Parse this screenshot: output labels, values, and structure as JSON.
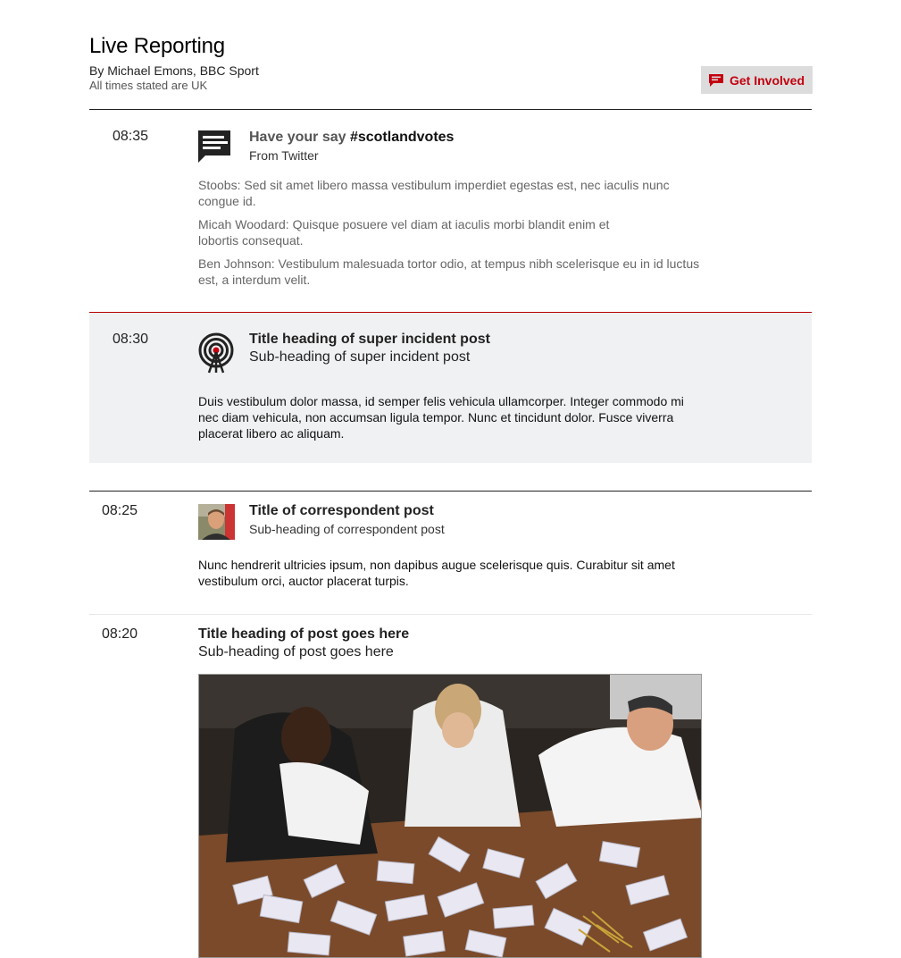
{
  "header": {
    "title": "Live Reporting",
    "byline": "By Michael Emons, BBC Sport",
    "times_note": "All times stated are UK",
    "get_involved_label": "Get Involved"
  },
  "posts": [
    {
      "time": "08:35",
      "title_prefix": "Have your say ",
      "title_hashtag": "#scotlandvotes",
      "source": "From Twitter",
      "icon": "speech-bubble-icon",
      "quotes": [
        "Stoobs: Sed sit amet libero massa vestibulum imperdiet egestas est, nec iaculis nunc congue id.",
        "Micah Woodard: Quisque posuere vel diam at iaculis morbi blandit enim et lobortis consequat.",
        "Ben Johnson: Vestibulum malesuada tortor odio, at tempus nibh scelerisque eu in id luctus est, a interdum velit."
      ]
    },
    {
      "time": "08:30",
      "title": "Title heading of super incident post",
      "subtitle": "Sub-heading of super incident post",
      "icon": "broadcast-tower-icon",
      "body": "Duis vestibulum dolor massa, id semper felis vehicula ullamcorper. Integer commodo mi nec diam vehicula, non accumsan ligula tempor. Nunc et tincidunt dolor. Fusce viverra placerat libero ac aliquam."
    },
    {
      "time": "08:25",
      "title": "Title of correspondent post",
      "subtitle": "Sub-heading of correspondent post",
      "icon": "correspondent-avatar",
      "body": "Nunc hendrerit ultricies ipsum, non dapibus augue scelerisque quis. Curabitur sit amet vestibulum orci, auctor placerat turpis."
    },
    {
      "time": "08:20",
      "title": "Title heading of post goes here",
      "subtitle": "Sub-heading of post goes here",
      "image": "vote-counting-photo"
    }
  ],
  "colors": {
    "accent_red": "#c4000f",
    "super_bg": "#f0f1f3",
    "super_rule": "#b80000"
  }
}
